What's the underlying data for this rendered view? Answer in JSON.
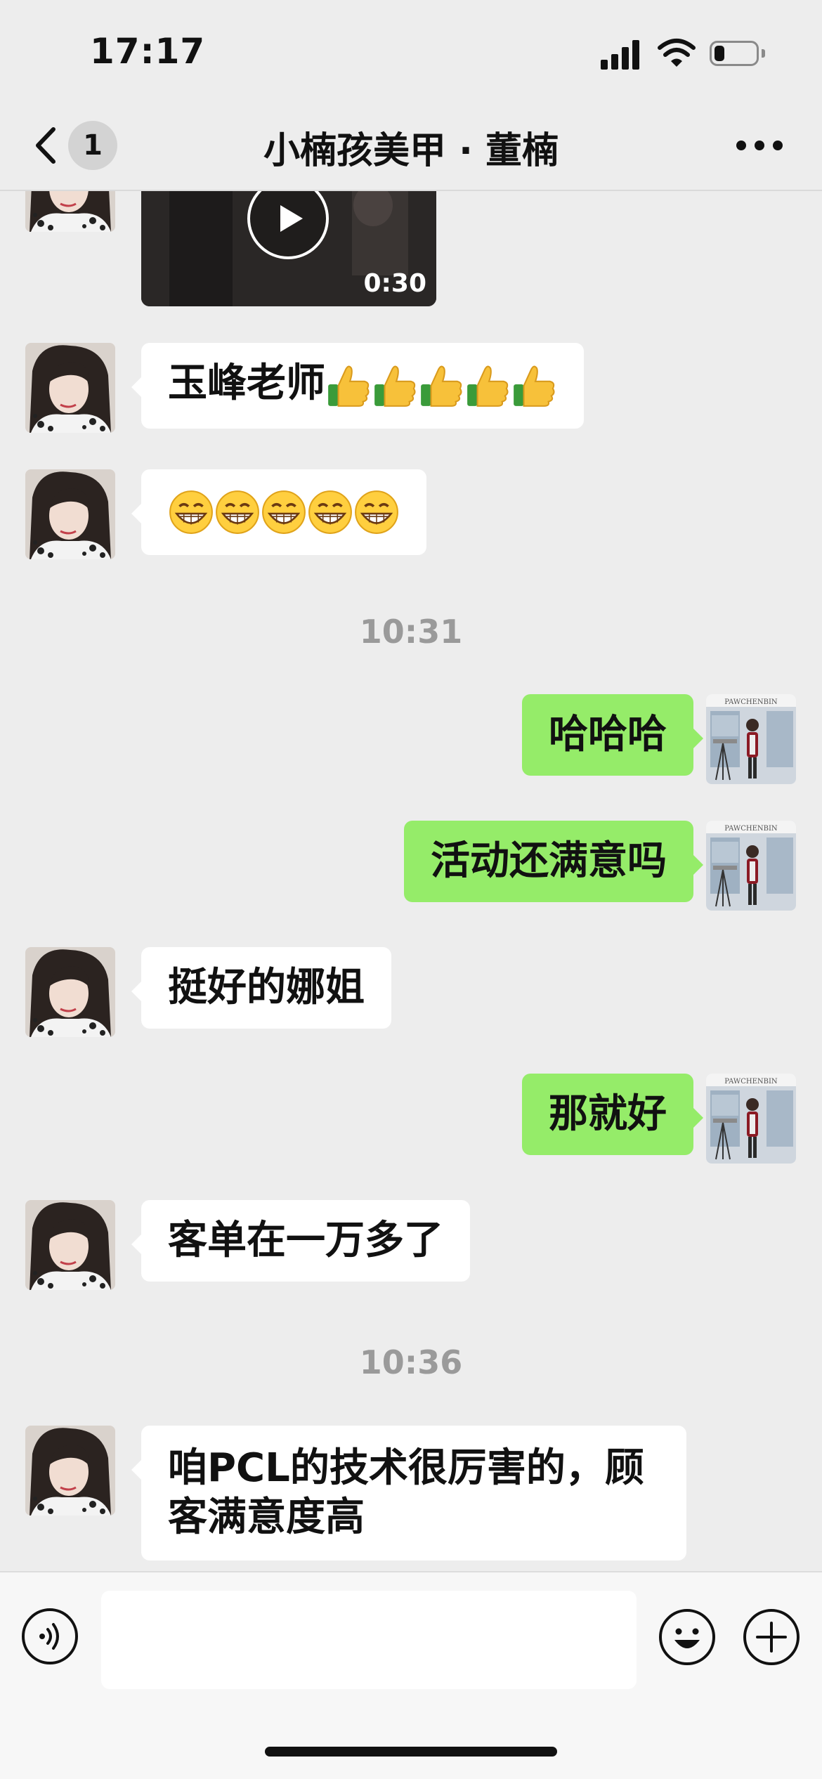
{
  "status_bar": {
    "time": "17:17",
    "battery_level": 0.25
  },
  "header": {
    "unread_count": "1",
    "title": "小楠孩美甲 · 董楠"
  },
  "messages": [
    {
      "id": "video",
      "type": "video",
      "direction": "incoming",
      "duration": "0:30"
    },
    {
      "id": "m1",
      "direction": "incoming",
      "text": "玉峰老师",
      "emoji": "thumbs-up",
      "emoji_count": 5
    },
    {
      "id": "m2",
      "direction": "incoming",
      "emoji": "grinning-face",
      "emoji_count": 5
    },
    {
      "id": "t1",
      "type": "time",
      "text": "10:31"
    },
    {
      "id": "m3",
      "direction": "outgoing",
      "text": "哈哈哈"
    },
    {
      "id": "m4",
      "direction": "outgoing",
      "text": "活动还满意吗"
    },
    {
      "id": "m5",
      "direction": "incoming",
      "text": "挺好的娜姐"
    },
    {
      "id": "m6",
      "direction": "outgoing",
      "text": "那就好"
    },
    {
      "id": "m7",
      "direction": "incoming",
      "text": "客单在一万多了"
    },
    {
      "id": "t2",
      "type": "time",
      "text": "10:36"
    },
    {
      "id": "m8",
      "direction": "incoming",
      "text": "咱PCL的技术很厉害的，顾客满意度高"
    }
  ],
  "input_bar": {
    "value": ""
  },
  "colors": {
    "background": "#ededed",
    "outgoing_bubble": "#95ec69",
    "incoming_bubble": "#ffffff"
  }
}
